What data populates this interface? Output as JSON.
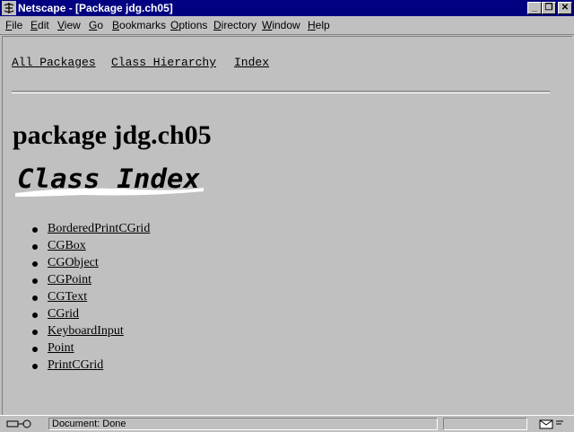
{
  "window": {
    "title": "Netscape - [Package jdg.ch05]",
    "minimize_glyph": "_",
    "restore_glyph": "❐",
    "close_glyph": "✕"
  },
  "menu": [
    {
      "accel": "F",
      "rest": "ile"
    },
    {
      "accel": "E",
      "rest": "dit"
    },
    {
      "accel": "V",
      "rest": "iew"
    },
    {
      "accel": "G",
      "rest": "o"
    },
    {
      "accel": "B",
      "rest": "ookmarks"
    },
    {
      "accel": "O",
      "rest": "ptions"
    },
    {
      "accel": "D",
      "rest": "irectory"
    },
    {
      "accel": "W",
      "rest": "indow"
    },
    {
      "accel": "H",
      "rest": "elp"
    }
  ],
  "nav": {
    "all_packages": "All Packages",
    "class_hierarchy": "Class Hierarchy",
    "index": "Index"
  },
  "page": {
    "title": "package jdg.ch05",
    "class_index_image_text": "Class Index"
  },
  "classes": [
    "BorderedPrintCGrid",
    "CGBox",
    "CGObject",
    "CGPoint",
    "CGText",
    "CGrid",
    "KeyboardInput",
    "Point",
    "PrintCGrid"
  ],
  "status": {
    "text": "Document: Done"
  },
  "colors": {
    "titlebar": "#000080",
    "face": "#c0c0c0"
  }
}
